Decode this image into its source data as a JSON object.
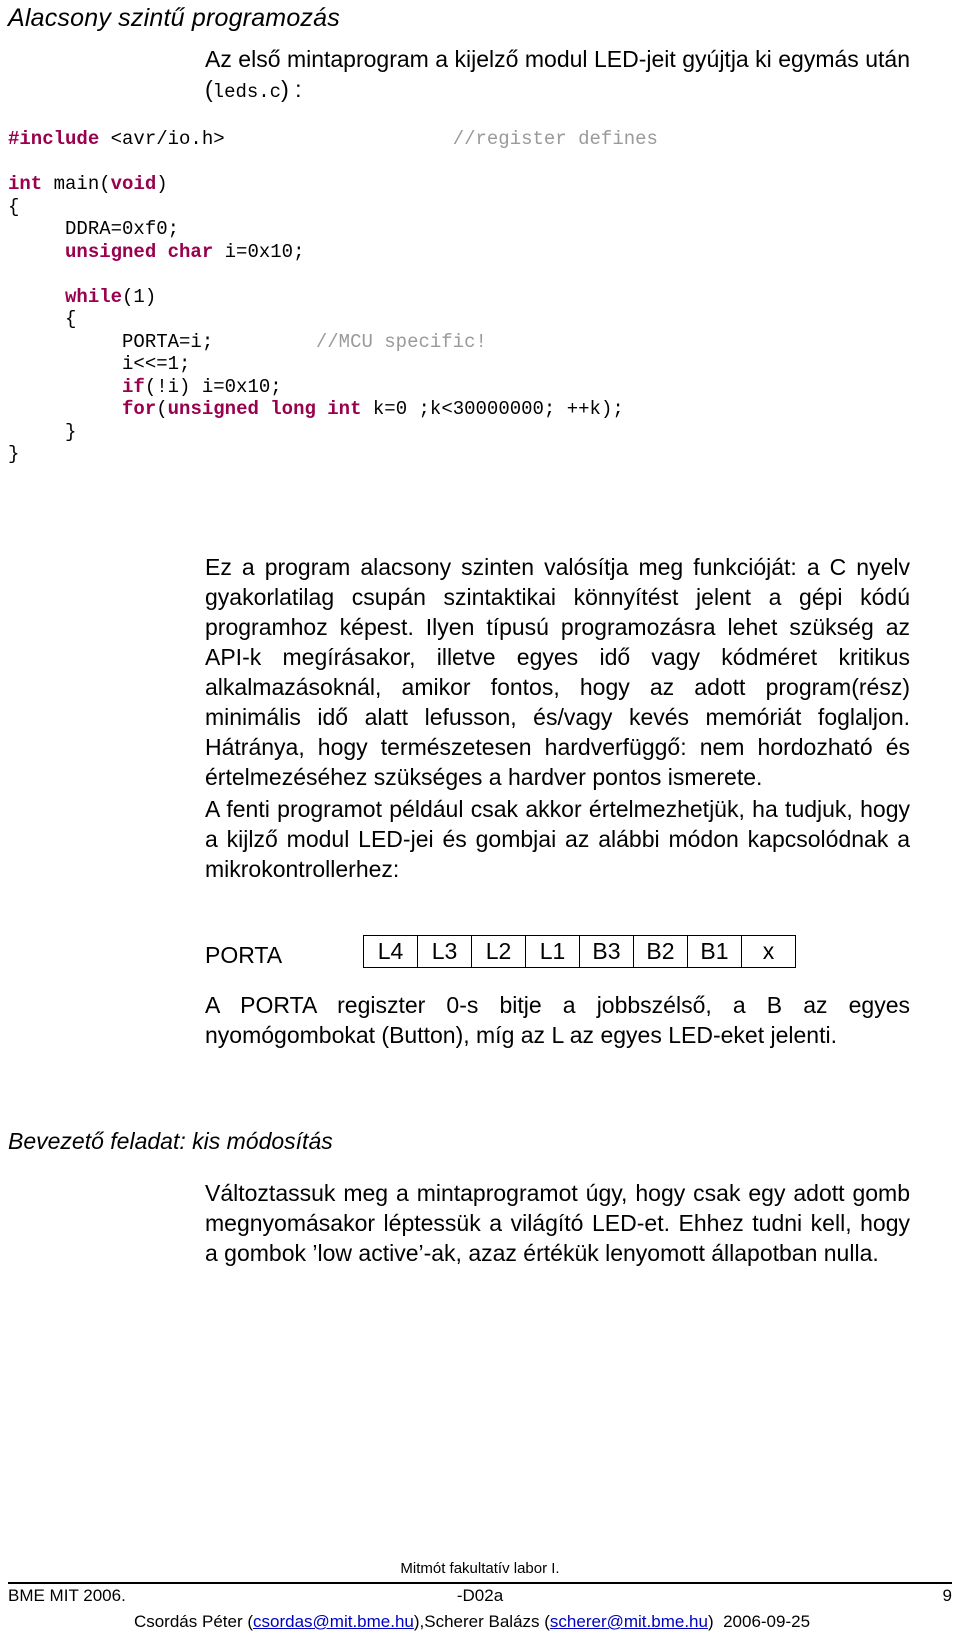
{
  "document": {
    "section_heading": "Alacsony szintű programozás",
    "intro": {
      "before_code": "Az első mintaprogram a kijelző modul LED-jeit gyújtja ki egymás után (",
      "file_name": "leds.c",
      "after_code": ") :"
    },
    "code": {
      "language": "c",
      "lines": [
        {
          "segments": [
            {
              "text": "#include",
              "style": "kw"
            },
            {
              "text": " <avr/io.h>",
              "style": "pln"
            },
            {
              "text": "                    ",
              "style": "pln"
            },
            {
              "text": "//register defines",
              "style": "cmt"
            }
          ]
        },
        {
          "segments": []
        },
        {
          "segments": [
            {
              "text": "int",
              "style": "kw"
            },
            {
              "text": " main(",
              "style": "pln"
            },
            {
              "text": "void",
              "style": "kw"
            },
            {
              "text": ")",
              "style": "pln"
            }
          ]
        },
        {
          "segments": [
            {
              "text": "{",
              "style": "pln"
            }
          ]
        },
        {
          "segments": [
            {
              "text": "     DDRA=0xf0;",
              "style": "pln"
            }
          ]
        },
        {
          "segments": [
            {
              "text": "     ",
              "style": "pln"
            },
            {
              "text": "unsigned char",
              "style": "kw"
            },
            {
              "text": " i=0x10;",
              "style": "pln"
            }
          ]
        },
        {
          "segments": []
        },
        {
          "segments": [
            {
              "text": "     ",
              "style": "pln"
            },
            {
              "text": "while",
              "style": "kw"
            },
            {
              "text": "(1)",
              "style": "pln"
            }
          ]
        },
        {
          "segments": [
            {
              "text": "     {",
              "style": "pln"
            }
          ]
        },
        {
          "segments": [
            {
              "text": "          PORTA=i;         ",
              "style": "pln"
            },
            {
              "text": "//MCU specific!",
              "style": "cmt"
            }
          ]
        },
        {
          "segments": [
            {
              "text": "          i<<=1;",
              "style": "pln"
            }
          ]
        },
        {
          "segments": [
            {
              "text": "          ",
              "style": "pln"
            },
            {
              "text": "if",
              "style": "kw"
            },
            {
              "text": "(!i) i=0x10;",
              "style": "pln"
            }
          ]
        },
        {
          "segments": [
            {
              "text": "          ",
              "style": "pln"
            },
            {
              "text": "for",
              "style": "kw"
            },
            {
              "text": "(",
              "style": "pln"
            },
            {
              "text": "unsigned long int",
              "style": "kw"
            },
            {
              "text": " k=0 ;k<30000000; ++k);",
              "style": "pln"
            }
          ]
        },
        {
          "segments": [
            {
              "text": "     }",
              "style": "pln"
            }
          ]
        },
        {
          "segments": [
            {
              "text": "}",
              "style": "pln"
            }
          ]
        }
      ]
    },
    "paragraphs": {
      "p1": "Ez a program alacsony szinten valósítja meg funkcióját: a C nyelv gyakorlatilag csupán szintaktikai könnyítést jelent a gépi kódú programhoz képest. Ilyen típusú programozásra lehet szükség az API-k megírásakor, illetve egyes idő vagy kódméret kritikus alkalmazásoknál, amikor fontos, hogy az adott program(rész) minimális idő alatt lefusson, és/vagy kevés memóriát foglaljon. Hátránya, hogy természetesen hardverfüggő: nem hordozható és értelmezéséhez szükséges a hardver pontos ismerete.",
      "p2": "A fenti programot például csak akkor értelmezhetjük, ha tudjuk, hogy a kijlző modul LED-jei és gombjai az alábbi módon kapcsolódnak a mikrokontrollerhez:",
      "p3": "A PORTA regiszter 0-s bitje a jobbszélső, a B az egyes nyomógombokat (Button), míg az L az egyes LED-eket jelenti.",
      "p4": "Változtassuk meg a mintaprogramot úgy, hogy csak egy adott gomb megnyomásakor léptessük a világító LED-et. Ehhez tudni kell, hogy a gombok ’low active’-ak, azaz értékük lenyomott állapotban nulla."
    },
    "porta": {
      "label": "PORTA",
      "bits": [
        "L4",
        "L3",
        "L2",
        "L1",
        "B3",
        "B2",
        "B1",
        "x"
      ]
    },
    "sub_heading": "Bevezető feladat: kis módosítás",
    "footer": {
      "course": "Mitmót fakultatív labor I.",
      "left": "BME MIT 2006.",
      "center": "-D02a",
      "page_number": "9",
      "author1_name": "Csordás Péter (",
      "author1_email": "csordas@mit.bme.hu",
      "between_authors": "),Scherer Balázs (",
      "author2_email": "scherer@mit.bme.hu",
      "after_authors": ")",
      "date": "2006-09-25"
    }
  },
  "colors": {
    "keyword": "#99004d",
    "comment": "#9a9a9a",
    "link": "#0000c0",
    "text": "#000000",
    "background": "#ffffff"
  }
}
